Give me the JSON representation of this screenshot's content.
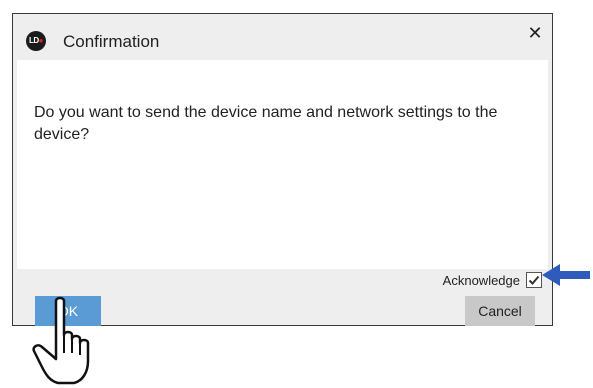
{
  "dialog": {
    "title": "Confirmation",
    "logo_icon": "ld-logo-icon",
    "close_label": "✕",
    "message": "Do you want to send the device name and network settings to the device?",
    "acknowledge": {
      "label": "Acknowledge",
      "checked": true
    },
    "buttons": {
      "ok_label": "OK",
      "cancel_label": "Cancel"
    }
  },
  "annotations": {
    "arrow_icon": "left-arrow-icon",
    "pointer_icon": "pointing-hand-icon"
  },
  "colors": {
    "ok_button": "#5b9bd5",
    "cancel_button": "#c8c8c8",
    "arrow": "#2f5bbd",
    "dialog_background": "#eeeeee"
  }
}
